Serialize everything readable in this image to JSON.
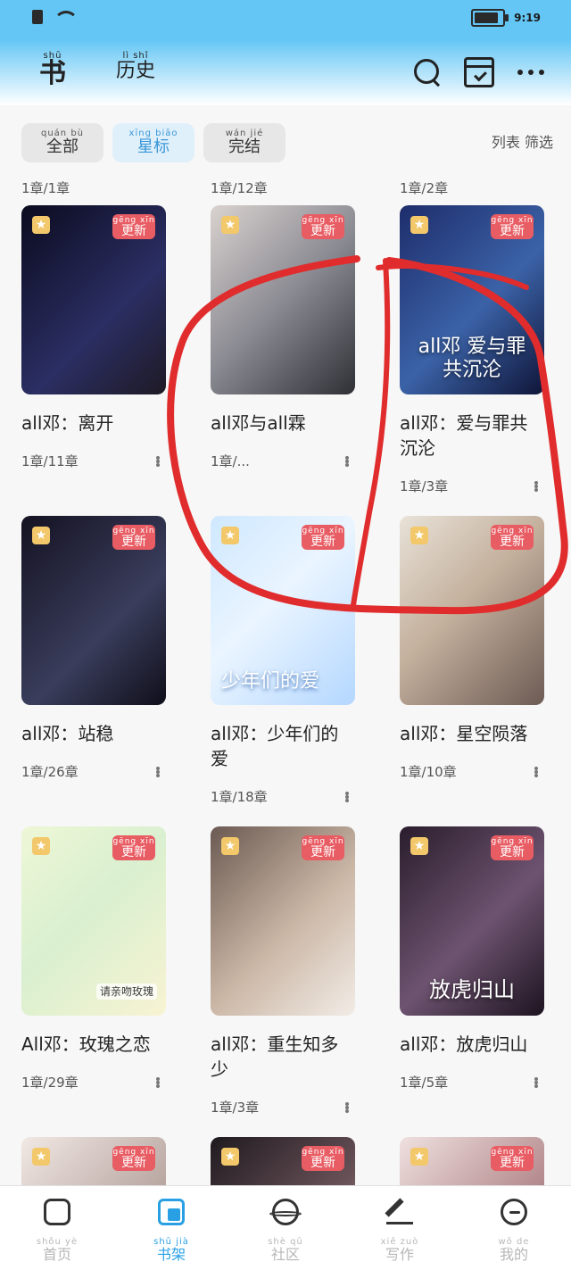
{
  "status": {
    "time": "9:19"
  },
  "header": {
    "tabs": [
      {
        "label": "书",
        "pinyin": "shū"
      },
      {
        "label": "历史",
        "pinyin": "lì  shǐ"
      }
    ]
  },
  "filters": {
    "chips": [
      {
        "label": "全部",
        "pinyin": "quán  bù"
      },
      {
        "label": "星标",
        "pinyin": "xīng  biāo"
      },
      {
        "label": "完结",
        "pinyin": "wán  jié"
      }
    ],
    "right": "列表  筛选"
  },
  "top_progress": [
    "1章/1章",
    "1章/12章",
    "1章/2章"
  ],
  "books": [
    {
      "title": "all邓：离开",
      "progress": "1章/11章",
      "badge": "更新",
      "badge_pinyin": "gēng xīn"
    },
    {
      "title": "all邓与all霖",
      "progress": "1章/...",
      "badge": "更新",
      "badge_pinyin": "gēng xīn"
    },
    {
      "title": "all邓：爱与罪共沉沦",
      "progress": "1章/3章",
      "badge": "更新",
      "badge_pinyin": "gēng xīn"
    },
    {
      "title": "all邓：站稳",
      "progress": "1章/26章",
      "badge": "更新",
      "badge_pinyin": "gēng xīn"
    },
    {
      "title": "all邓：少年们的爱",
      "progress": "1章/18章",
      "badge": "更新",
      "badge_pinyin": "gēng xīn"
    },
    {
      "title": "all邓：星空陨落",
      "progress": "1章/10章",
      "badge": "更新",
      "badge_pinyin": "gēng xīn"
    },
    {
      "title": "All邓：玫瑰之恋",
      "progress": "1章/29章",
      "badge": "更新",
      "badge_pinyin": "gēng xīn"
    },
    {
      "title": "all邓：重生知多少",
      "progress": "1章/3章",
      "badge": "更新",
      "badge_pinyin": "gēng xīn"
    },
    {
      "title": "all邓：放虎归山",
      "progress": "1章/5章",
      "badge": "更新",
      "badge_pinyin": "gēng xīn"
    },
    {
      "title": "",
      "progress": "",
      "badge": "更新",
      "badge_pinyin": "gēng xīn"
    },
    {
      "title": "",
      "progress": "",
      "badge": "更新",
      "badge_pinyin": "gēng xīn"
    },
    {
      "title": "",
      "progress": "",
      "badge": "更新",
      "badge_pinyin": "gēng xīn"
    }
  ],
  "covers": {
    "c3": "all邓 爱与罪 共沉沦",
    "c5": "少年们的爱",
    "c7": "请亲吻玫瑰",
    "c9": "放虎归山"
  },
  "nav": [
    {
      "label": "首页",
      "pinyin": "shǒu yè",
      "icon": "home-icon"
    },
    {
      "label": "书架",
      "pinyin": "shū jià",
      "icon": "bookshelf-icon"
    },
    {
      "label": "社区",
      "pinyin": "shè qū",
      "icon": "planet-icon"
    },
    {
      "label": "写作",
      "pinyin": "xiě zuò",
      "icon": "pen-icon"
    },
    {
      "label": "我的",
      "pinyin": "wǒ de",
      "icon": "chat-icon"
    }
  ],
  "colors": {
    "accent": "#2aa0e4",
    "badge": "#e85c63",
    "star": "#f2c86b",
    "annotation": "#e02c2c"
  }
}
